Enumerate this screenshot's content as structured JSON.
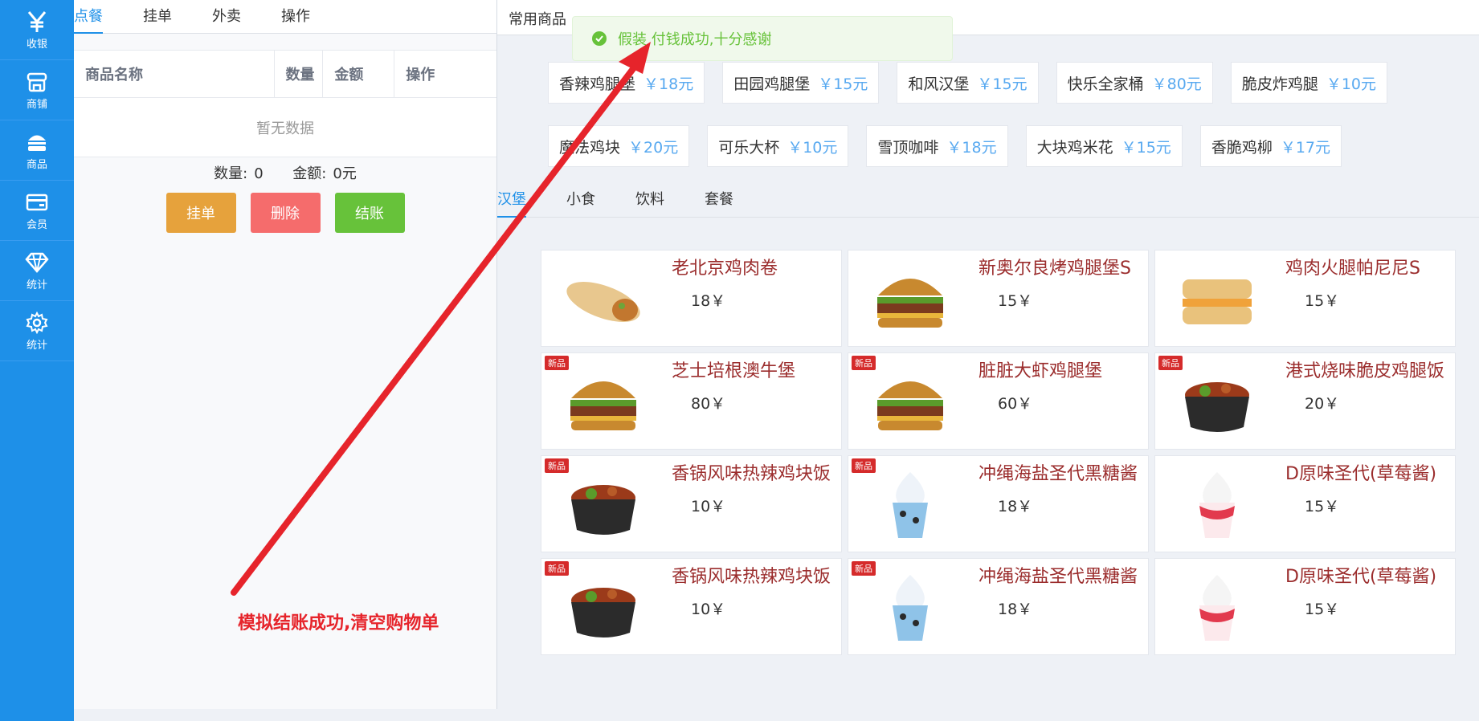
{
  "sidebar": {
    "items": [
      {
        "label": "收银",
        "icon": "yen-icon"
      },
      {
        "label": "商铺",
        "icon": "store-icon"
      },
      {
        "label": "商品",
        "icon": "burger-icon"
      },
      {
        "label": "会员",
        "icon": "card-icon"
      },
      {
        "label": "统计",
        "icon": "diamond-icon"
      },
      {
        "label": "统计",
        "icon": "gear-icon"
      }
    ]
  },
  "order": {
    "tabs": [
      "点餐",
      "挂单",
      "外卖",
      "操作"
    ],
    "columns": [
      "商品名称",
      "数量",
      "金额",
      "操作"
    ],
    "empty_text": "暂无数据",
    "qty_label": "数量:",
    "qty_value": "0",
    "amount_label": "金额:",
    "amount_value": "0元",
    "buttons": {
      "hold": "挂单",
      "delete": "删除",
      "checkout": "结账"
    }
  },
  "common": {
    "title": "常用商品",
    "items": [
      {
        "name": "香辣鸡腿堡",
        "price": "￥18元"
      },
      {
        "name": "田园鸡腿堡",
        "price": "￥15元"
      },
      {
        "name": "和风汉堡",
        "price": "￥15元"
      },
      {
        "name": "快乐全家桶",
        "price": "￥80元"
      },
      {
        "name": "脆皮炸鸡腿",
        "price": "￥10元"
      },
      {
        "name": "魔法鸡块",
        "price": "￥20元"
      },
      {
        "name": "可乐大杯",
        "price": "￥10元"
      },
      {
        "name": "雪顶咖啡",
        "price": "￥18元"
      },
      {
        "name": "大块鸡米花",
        "price": "￥15元"
      },
      {
        "name": "香脆鸡柳",
        "price": "￥17元"
      }
    ]
  },
  "categories": [
    "汉堡",
    "小食",
    "饮料",
    "套餐"
  ],
  "goods": [
    {
      "name": "老北京鸡肉卷",
      "price": "18￥",
      "badge": ""
    },
    {
      "name": "新奥尔良烤鸡腿堡S",
      "price": "15￥",
      "badge": ""
    },
    {
      "name": "鸡肉火腿帕尼尼S",
      "price": "15￥",
      "badge": ""
    },
    {
      "name": "芝士培根澳牛堡",
      "price": "80￥",
      "badge": "新品"
    },
    {
      "name": "脏脏大虾鸡腿堡",
      "price": "60￥",
      "badge": "新品"
    },
    {
      "name": "港式烧味脆皮鸡腿饭",
      "price": "20￥",
      "badge": "新品"
    },
    {
      "name": "香锅风味热辣鸡块饭",
      "price": "10￥",
      "badge": "新品"
    },
    {
      "name": "冲绳海盐圣代黑糖酱",
      "price": "18￥",
      "badge": "新品"
    },
    {
      "name": "D原味圣代(草莓酱)",
      "price": "15￥",
      "badge": ""
    },
    {
      "name": "香锅风味热辣鸡块饭",
      "price": "10￥",
      "badge": "新品"
    },
    {
      "name": "冲绳海盐圣代黑糖酱",
      "price": "18￥",
      "badge": "新品"
    },
    {
      "name": "D原味圣代(草莓酱)",
      "price": "15￥",
      "badge": ""
    }
  ],
  "toast": {
    "message": "假装 付钱成功,十分感谢"
  },
  "annotation": {
    "text": "模拟结账成功,清空购物单"
  },
  "colors": {
    "sidebar": "#1e90e8",
    "accent": "#1e90e8",
    "success": "#67c23a",
    "annotation": "#e6242b"
  }
}
